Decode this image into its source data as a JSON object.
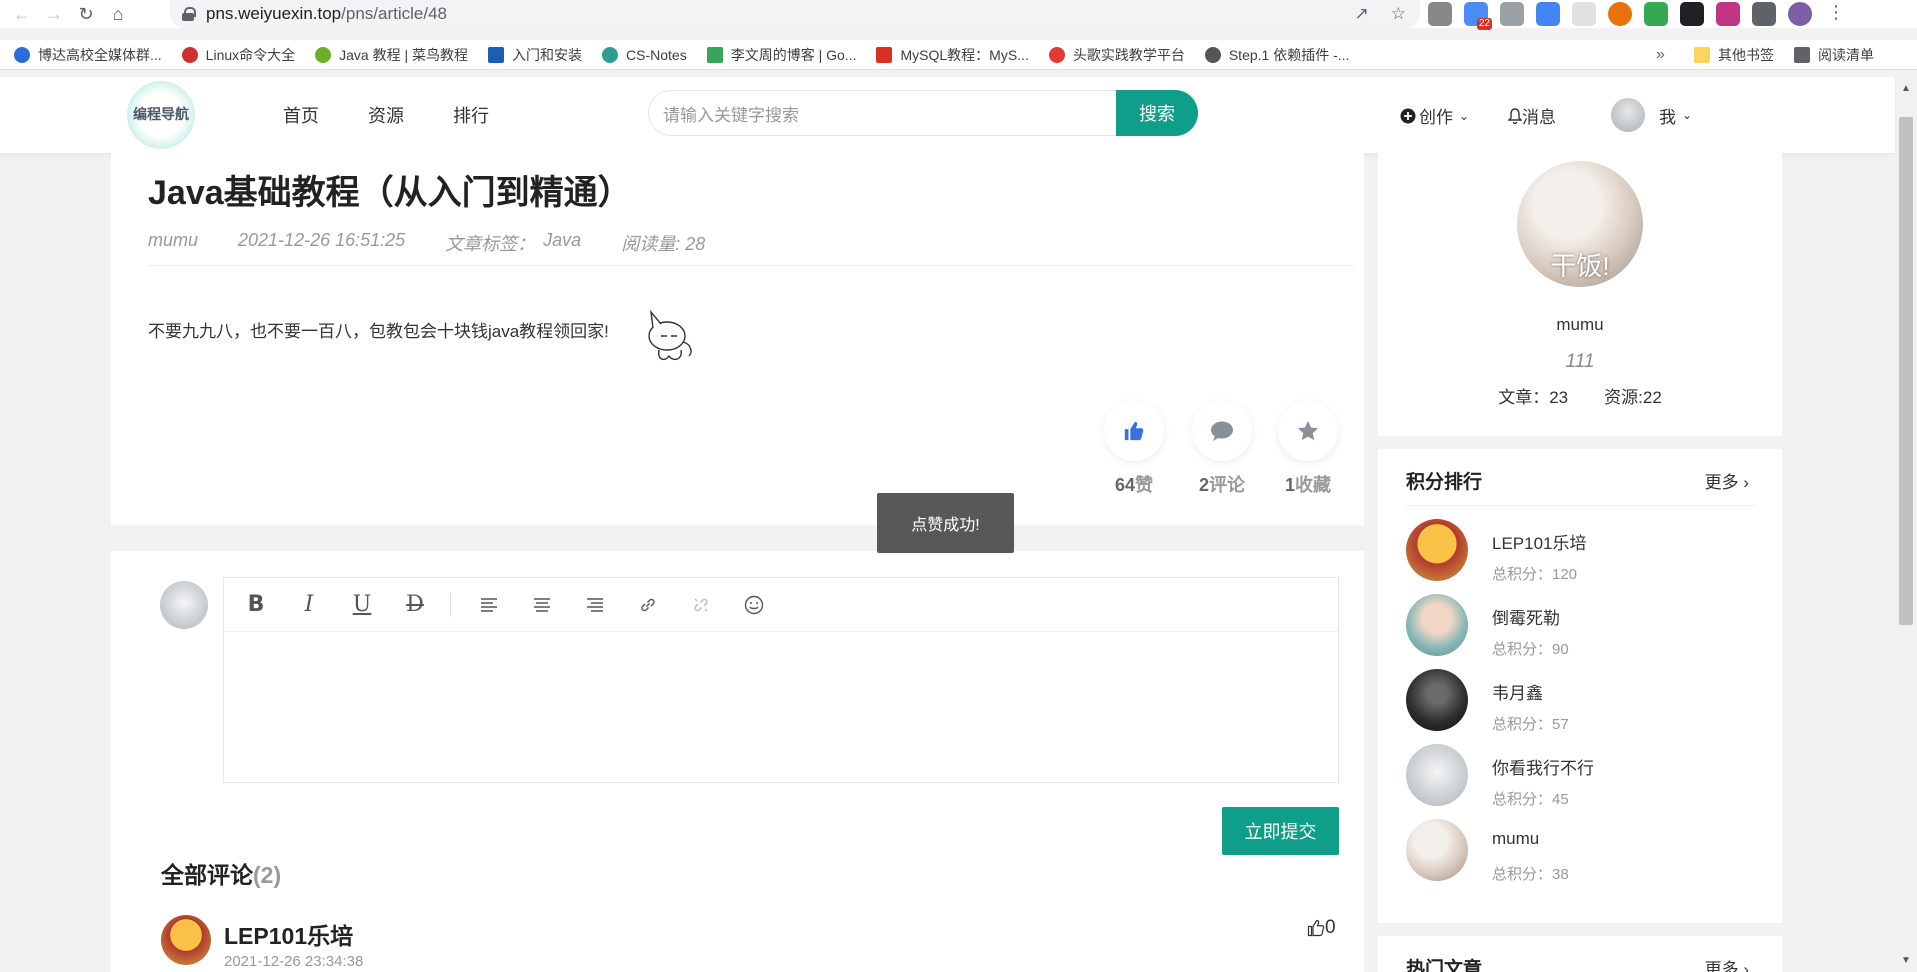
{
  "browser": {
    "url_host": "pns.weiyuexin.top",
    "url_path": "/pns/article/48",
    "ext_badge": "22",
    "bookmarks": [
      {
        "label": "博达高校全媒体群...",
        "color": "#2a6dd9"
      },
      {
        "label": "Linux命令大全",
        "color": "#d0312d"
      },
      {
        "label": "Java 教程 | 菜鸟教程",
        "color": "#6aaf2a"
      },
      {
        "label": "入门和安装",
        "color": "#1a5fb4"
      },
      {
        "label": "CS-Notes",
        "color": "#2f9e8f"
      },
      {
        "label": "李文周的博客 | Go...",
        "color": "#38a35a"
      },
      {
        "label": "MySQL教程：MyS...",
        "color": "#d93025"
      },
      {
        "label": "头歌实践教学平台",
        "color": "#e53935"
      },
      {
        "label": "Step.1 依赖插件 -...",
        "color": "#555555"
      }
    ],
    "bookmarks_more": "»",
    "other_bookmarks": "其他书签",
    "reading_list": "阅读清单"
  },
  "header": {
    "logo_text": "编程导航",
    "nav": [
      "首页",
      "资源",
      "排行"
    ],
    "search_placeholder": "请输入关键字搜索",
    "search_button": "搜索",
    "create": "创作",
    "messages": "消息",
    "me": "我",
    "accent": "#0f9e8a"
  },
  "article": {
    "title": "Java基础教程（从入门到精通）",
    "author": "mumu",
    "date": "2021-12-26 16:51:25",
    "tags_label": "文章标签：",
    "tag": "Java",
    "views_label": "阅读量: 28",
    "body": "不要九九八，也不要一百八，包教包会十块钱java教程领回家!",
    "likes": {
      "count": "64",
      "label": "赞"
    },
    "comments": {
      "count": "2",
      "label": "评论"
    },
    "favorites": {
      "count": "1",
      "label": "收藏"
    }
  },
  "toast": "点赞成功!",
  "comment_section": {
    "submit": "立即提交",
    "all_comments": "全部评论",
    "count": "(2)",
    "first": {
      "name": "LEP101乐培",
      "date": "2021-12-26 23:34:38",
      "likes": "0"
    }
  },
  "profile": {
    "name": "mumu",
    "motto": "111",
    "avatar_caption": "干饭!",
    "articles": "文章：23",
    "resources": "资源:22"
  },
  "ranking": {
    "title": "积分排行",
    "more": "更多",
    "items": [
      {
        "name": "LEP101乐培",
        "score": "总积分：120"
      },
      {
        "name": "倒霉死勒",
        "score": "总积分：90"
      },
      {
        "name": "韦月鑫",
        "score": "总积分：57"
      },
      {
        "name": "你看我行不行",
        "score": "总积分：45"
      },
      {
        "name": "mumu",
        "score": "总积分：38"
      }
    ]
  },
  "hot": {
    "title": "热门文章",
    "more": "更多"
  }
}
